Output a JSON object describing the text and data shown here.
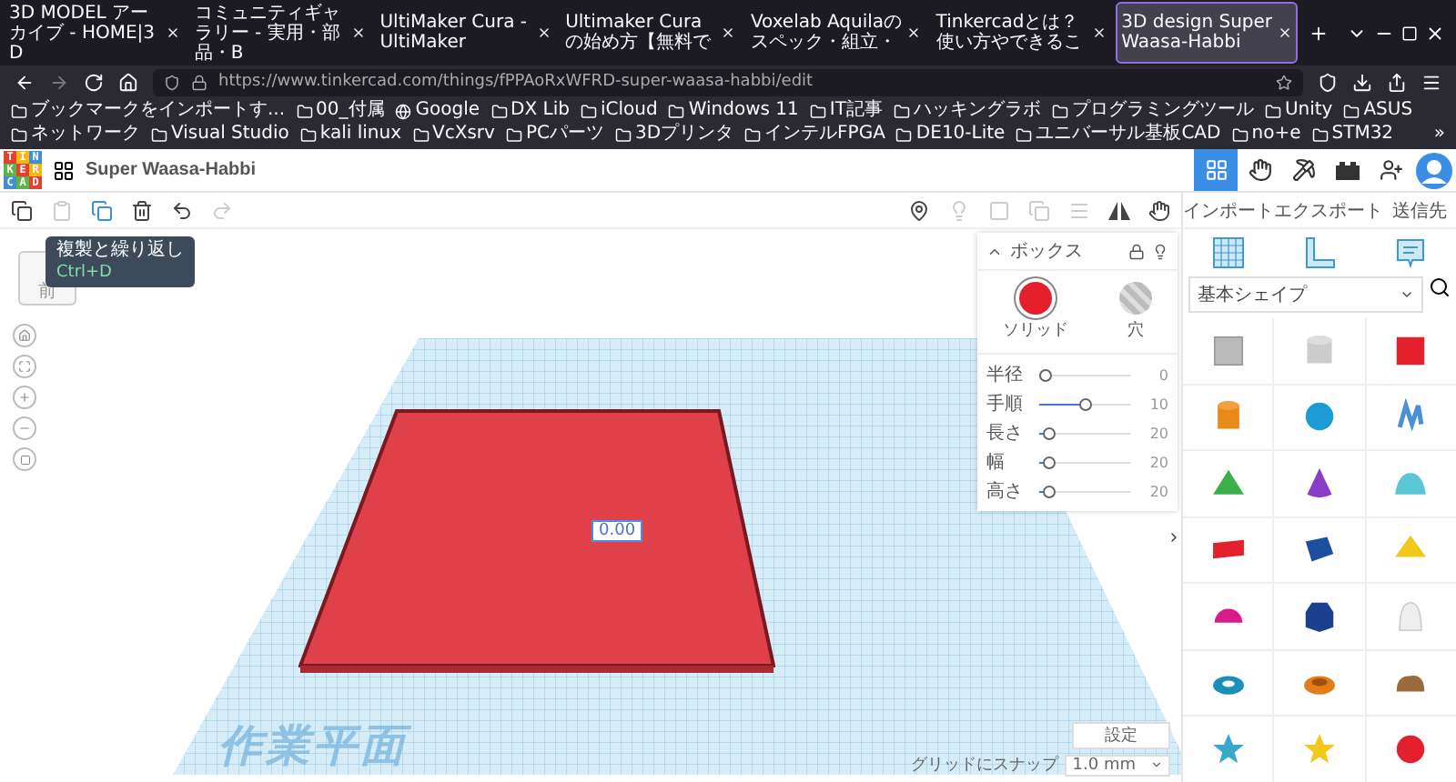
{
  "browser": {
    "tabs": [
      {
        "title": "3D MODEL アーカイブ - HOME|3D",
        "selected": false
      },
      {
        "title": "コミュニティギャラリー - 実用・部品・B",
        "selected": false
      },
      {
        "title": "UltiMaker Cura - UltiMaker",
        "selected": false
      },
      {
        "title": "Ultimaker Curaの始め方【無料で",
        "selected": false
      },
      {
        "title": "Voxelab Aquilaのスペック・組立・",
        "selected": false
      },
      {
        "title": "Tinkercadとは？使い方やできるこ",
        "selected": false
      },
      {
        "title": "3D design Super Waasa-Habbi",
        "selected": true
      }
    ],
    "url": "https://www.tinkercad.com/things/fPPAoRxWFRD-super-waasa-habbi/edit",
    "bookmarks": [
      "ブックマークをインポートす...",
      "00_付属",
      "Google",
      "DX Lib",
      "iCloud",
      "Windows 11",
      "IT記事",
      "ハッキングラボ",
      "プログラミングツール",
      "Unity",
      "ASUS",
      "ネットワーク",
      "Visual Studio",
      "kali linux",
      "VcXsrv",
      "PCパーツ",
      "3Dプリンタ",
      "インテルFPGA",
      "DE10-Lite",
      "ユニバーサル基板CAD",
      "no+e",
      "STM32"
    ],
    "bookmarks_more": "»"
  },
  "app": {
    "logo": [
      "T",
      "I",
      "N",
      "K",
      "E",
      "R",
      "C",
      "A",
      "D"
    ],
    "title": "Super Waasa-Habbi"
  },
  "tooltip": {
    "title": "複製と繰り返し",
    "shortcut": "Ctrl+D"
  },
  "view_cube": {
    "face": "前"
  },
  "side_actions": [
    "インポート",
    "エクスポート",
    "送信先"
  ],
  "shape_library": {
    "category": "基本シェイプ"
  },
  "inspector": {
    "title": "ボックス",
    "modes": [
      {
        "label": "ソリッド",
        "selected": true
      },
      {
        "label": "穴",
        "selected": false
      }
    ],
    "params": [
      {
        "label": "半径",
        "value": "0",
        "level": 0.05
      },
      {
        "label": "手順",
        "value": "10",
        "level": 0.5
      },
      {
        "label": "長さ",
        "value": "20",
        "level": 0.1
      },
      {
        "label": "幅",
        "value": "20",
        "level": 0.1
      },
      {
        "label": "高さ",
        "value": "20",
        "level": 0.1
      }
    ]
  },
  "canvas": {
    "dimension": "0.00",
    "workplane_label": "作業平面"
  },
  "footer": {
    "settings": "設定",
    "snap_label": "グリッドにスナップ",
    "snap_value": "1.0 mm"
  }
}
